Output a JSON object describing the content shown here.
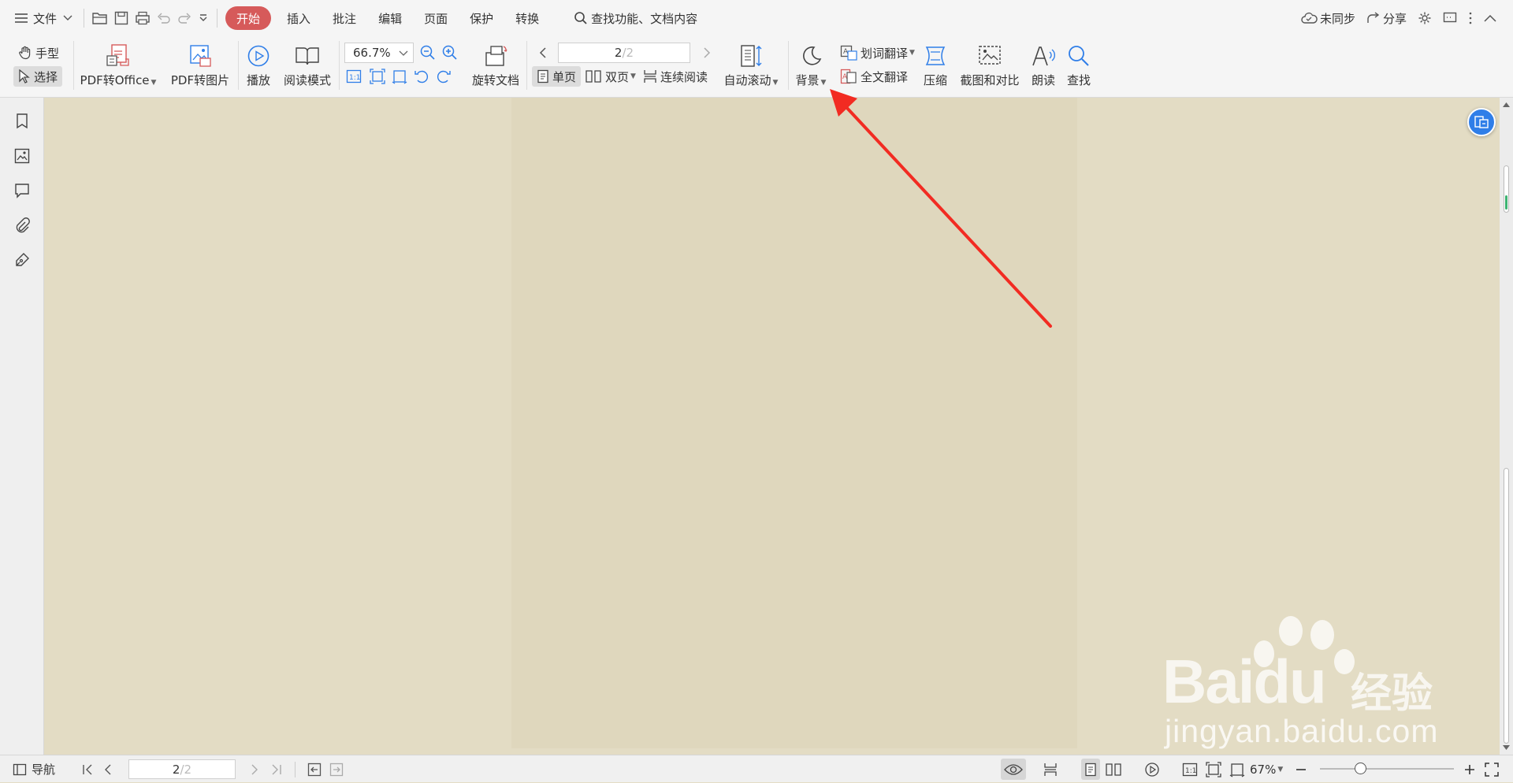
{
  "menubar": {
    "file_label": "文件",
    "tabs": [
      {
        "label": "开始",
        "active": true
      },
      {
        "label": "插入"
      },
      {
        "label": "批注"
      },
      {
        "label": "编辑"
      },
      {
        "label": "页面"
      },
      {
        "label": "保护"
      },
      {
        "label": "转换"
      }
    ],
    "search_label": "查找功能、文档内容",
    "sync_label": "未同步",
    "share_label": "分享"
  },
  "ribbon": {
    "hand_label": "手型",
    "select_label": "选择",
    "pdf_to_office": "PDF转Office",
    "pdf_to_image": "PDF转图片",
    "play": "播放",
    "read_mode": "阅读模式",
    "zoom_value": "66.7%",
    "rotate_doc": "旋转文档",
    "page_current": "2",
    "page_total": "/2",
    "single_page": "单页",
    "double_page": "双页",
    "continuous": "连续阅读",
    "auto_scroll": "自动滚动",
    "background": "背景",
    "word_translate": "划词翻译",
    "full_translate": "全文翻译",
    "compress": "压缩",
    "screenshot_compare": "截图和对比",
    "read_aloud": "朗读",
    "find": "查找"
  },
  "statusbar": {
    "nav_label": "导航",
    "page_current": "2",
    "page_total": "/2",
    "zoom_value": "67%"
  },
  "watermark": {
    "brand": "Bai",
    "brand2": "du",
    "cn": "经验",
    "url": "jingyan.baidu.com"
  },
  "colors": {
    "accent_tab": "#d65a5a",
    "arrow": "#f22b22",
    "document_bg": "#e3dcc4",
    "float_button": "#2f7ee8"
  }
}
